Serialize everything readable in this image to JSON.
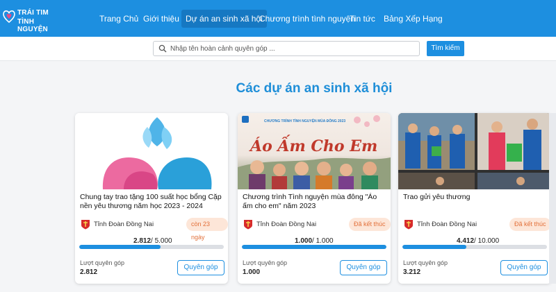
{
  "brand": {
    "line1": "TRÁI TIM",
    "line2": "TÌNH NGUYỆN"
  },
  "nav": {
    "items": [
      {
        "label": "Trang Chủ"
      },
      {
        "label": "Giới thiệu"
      },
      {
        "label": "Dự án an sinh xã hội",
        "active": true
      },
      {
        "label": "Chương trình tình nguyện"
      },
      {
        "label": "Tin tức"
      },
      {
        "label": "Bảng Xếp Hạng"
      }
    ]
  },
  "search": {
    "placeholder": "Nhập tên hoàn cảnh quyên góp ...",
    "button": "Tìm kiếm",
    "icon": "search-icon"
  },
  "page": {
    "title": "Các dự án an sinh xã hội"
  },
  "colors": {
    "primary": "#1d8fe0",
    "badge_bg": "#fde6d8",
    "badge_text": "#e2703a"
  },
  "cards": [
    {
      "title": "Chung tay trao tặng 100 suất học bổng Cặp nền yêu thương năm học 2023 - 2024",
      "org": "Tỉnh Đoàn Đồng Nai",
      "badge": "còn 23 ngày",
      "raised": "2.812",
      "goal": "/ 5.000",
      "progress": 0.5624,
      "donation_label": "Lượt quyên góp",
      "donations": "2.812",
      "button": "Quyên góp"
    },
    {
      "title": "Chương trình Tình nguyện mùa đông \"Áo ấm cho em\" năm 2023",
      "org": "Tỉnh Đoàn Đồng Nai",
      "badge": "Đã kết thúc",
      "raised": "1.000",
      "goal": "/ 1.000",
      "progress": 1.0,
      "donation_label": "Lượt quyên góp",
      "donations": "1.000",
      "button": "Quyên góp",
      "banner_top": "CHƯƠNG TRÌNH TÌNH NGUYỆN MÙA ĐÔNG 2023",
      "banner_main": "Áo Ấm Cho Em"
    },
    {
      "title": "Trao gửi yêu thương",
      "org": "Tỉnh Đoàn Đồng Nai",
      "badge": "Đã kết thúc",
      "raised": "4.412",
      "goal": "/ 10.000",
      "progress": 0.4412,
      "donation_label": "Lượt quyên góp",
      "donations": "3.212",
      "button": "Quyên góp"
    }
  ]
}
